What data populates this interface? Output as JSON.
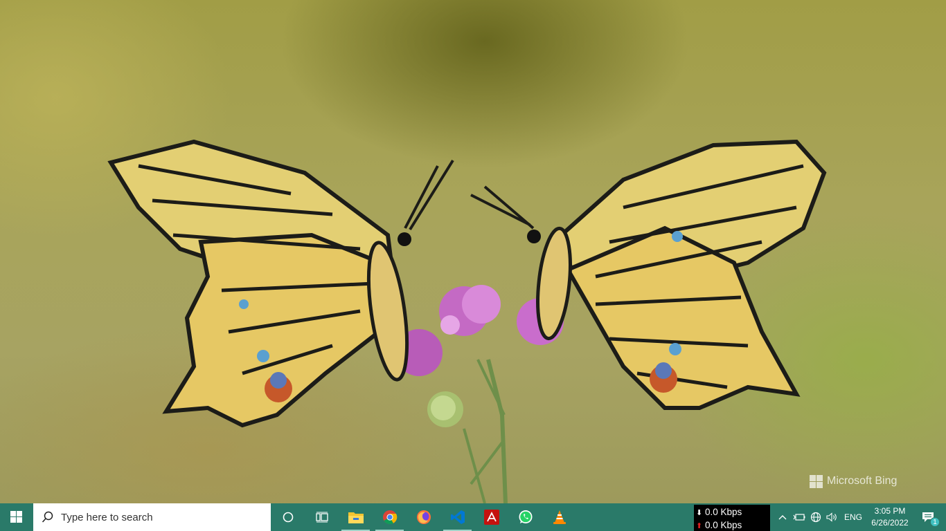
{
  "wallpaper": {
    "watermark": "Microsoft Bing"
  },
  "taskbar": {
    "search_placeholder": "Type here to search",
    "pinned": [
      {
        "icon": "cortana-circle-icon"
      },
      {
        "icon": "task-view-icon"
      },
      {
        "icon": "file-explorer-icon",
        "active": true
      },
      {
        "icon": "chrome-icon",
        "active": true
      },
      {
        "icon": "firefox-icon"
      },
      {
        "icon": "vscode-icon",
        "active": true
      },
      {
        "icon": "acrobat-icon"
      },
      {
        "icon": "whatsapp-icon"
      },
      {
        "icon": "vlc-icon"
      }
    ],
    "netspeed": {
      "down": "0.0 Kbps",
      "up": "0.0 Kbps"
    },
    "tray": {
      "language": "ENG",
      "time": "3:05 PM",
      "date": "6/26/2022",
      "notification_count": "1"
    },
    "colors": {
      "taskbar": "#2a7a69",
      "accent": "#9fd3c8"
    }
  }
}
